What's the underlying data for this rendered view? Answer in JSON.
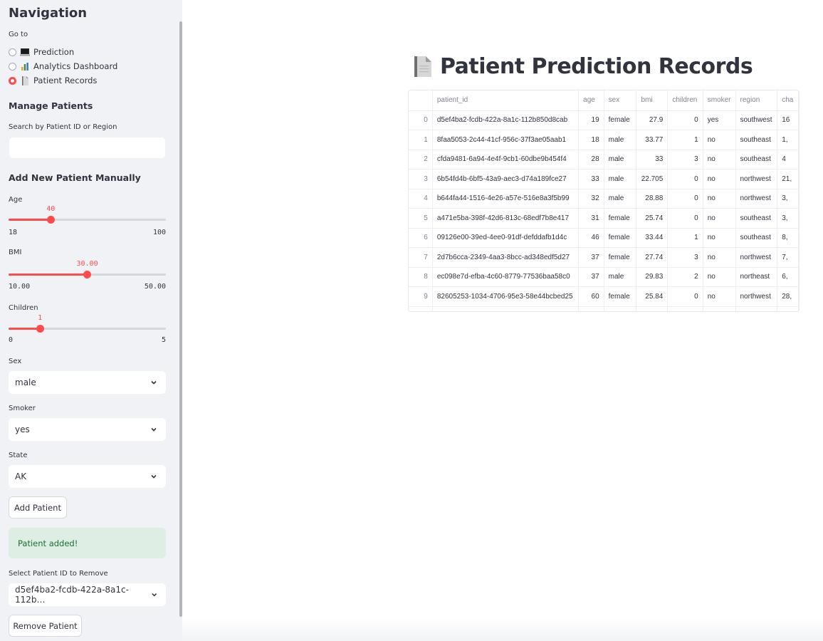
{
  "sidebar": {
    "title": "Navigation",
    "goto_label": "Go to",
    "nav": [
      {
        "label": "Prediction",
        "icon": "laptop-icon",
        "selected": false
      },
      {
        "label": "Analytics Dashboard",
        "icon": "bar-chart-icon",
        "selected": false
      },
      {
        "label": "Patient Records",
        "icon": "document-icon",
        "selected": true
      }
    ],
    "manage_title": "Manage Patients",
    "search_label": "Search by Patient ID or Region",
    "search_value": "",
    "add_title": "Add New Patient Manually",
    "age": {
      "label": "Age",
      "value": "40",
      "min": "18",
      "max": "100",
      "fraction": 0.268
    },
    "bmi": {
      "label": "BMI",
      "value": "30.00",
      "min": "10.00",
      "max": "50.00",
      "fraction": 0.5
    },
    "children": {
      "label": "Children",
      "value": "1",
      "min": "0",
      "max": "5",
      "fraction": 0.2
    },
    "sex": {
      "label": "Sex",
      "value": "male"
    },
    "smoker": {
      "label": "Smoker",
      "value": "yes"
    },
    "state": {
      "label": "State",
      "value": "AK"
    },
    "add_button": "Add Patient",
    "success_message": "Patient added!",
    "remove_label": "Select Patient ID to Remove",
    "remove_value": "d5ef4ba2-fcdb-422a-8a1c-112b…",
    "remove_button": "Remove Patient"
  },
  "main": {
    "title": "Patient Prediction Records",
    "columns": [
      "",
      "patient_id",
      "age",
      "sex",
      "bmi",
      "children",
      "smoker",
      "region",
      "cha"
    ],
    "rows": [
      [
        "0",
        "d5ef4ba2-fcdb-422a-8a1c-112b850d8cab",
        "19",
        "female",
        "27.9",
        "0",
        "yes",
        "southwest",
        "16"
      ],
      [
        "1",
        "8faa5053-2c44-41cf-956c-37f3ae05aab1",
        "18",
        "male",
        "33.77",
        "1",
        "no",
        "southeast",
        "1,"
      ],
      [
        "2",
        "cfda9481-6a94-4e4f-9cb1-60dbe9b454f4",
        "28",
        "male",
        "33",
        "3",
        "no",
        "southeast",
        "4"
      ],
      [
        "3",
        "6b54fd4b-6bf5-43a9-aec3-d74a189fce27",
        "33",
        "male",
        "22.705",
        "0",
        "no",
        "northwest",
        "21,"
      ],
      [
        "4",
        "b644fa44-1516-4e26-a57e-516e8a3f5b99",
        "32",
        "male",
        "28.88",
        "0",
        "no",
        "northwest",
        "3,"
      ],
      [
        "5",
        "a471e5ba-398f-42d6-813c-68edf7b8e417",
        "31",
        "female",
        "25.74",
        "0",
        "no",
        "southeast",
        "3,"
      ],
      [
        "6",
        "09126e00-39ed-4ee0-91df-defddafb1d4c",
        "46",
        "female",
        "33.44",
        "1",
        "no",
        "southeast",
        "8,"
      ],
      [
        "7",
        "2d7b6cca-2349-4aa3-8bcc-ad348edf5d27",
        "37",
        "female",
        "27.74",
        "3",
        "no",
        "northwest",
        "7,"
      ],
      [
        "8",
        "ec098e7d-efba-4c60-8779-77536baa58c0",
        "37",
        "male",
        "29.83",
        "2",
        "no",
        "northeast",
        "6,"
      ],
      [
        "9",
        "82605253-1034-4706-95e3-58e44bcbed25",
        "60",
        "female",
        "25.84",
        "0",
        "no",
        "northwest",
        "28,"
      ]
    ]
  },
  "colors": {
    "accent": "#ff4b4b",
    "sidebar_bg": "#f0f2f6",
    "success_bg": "#dfeee4",
    "success_text": "#177233"
  }
}
